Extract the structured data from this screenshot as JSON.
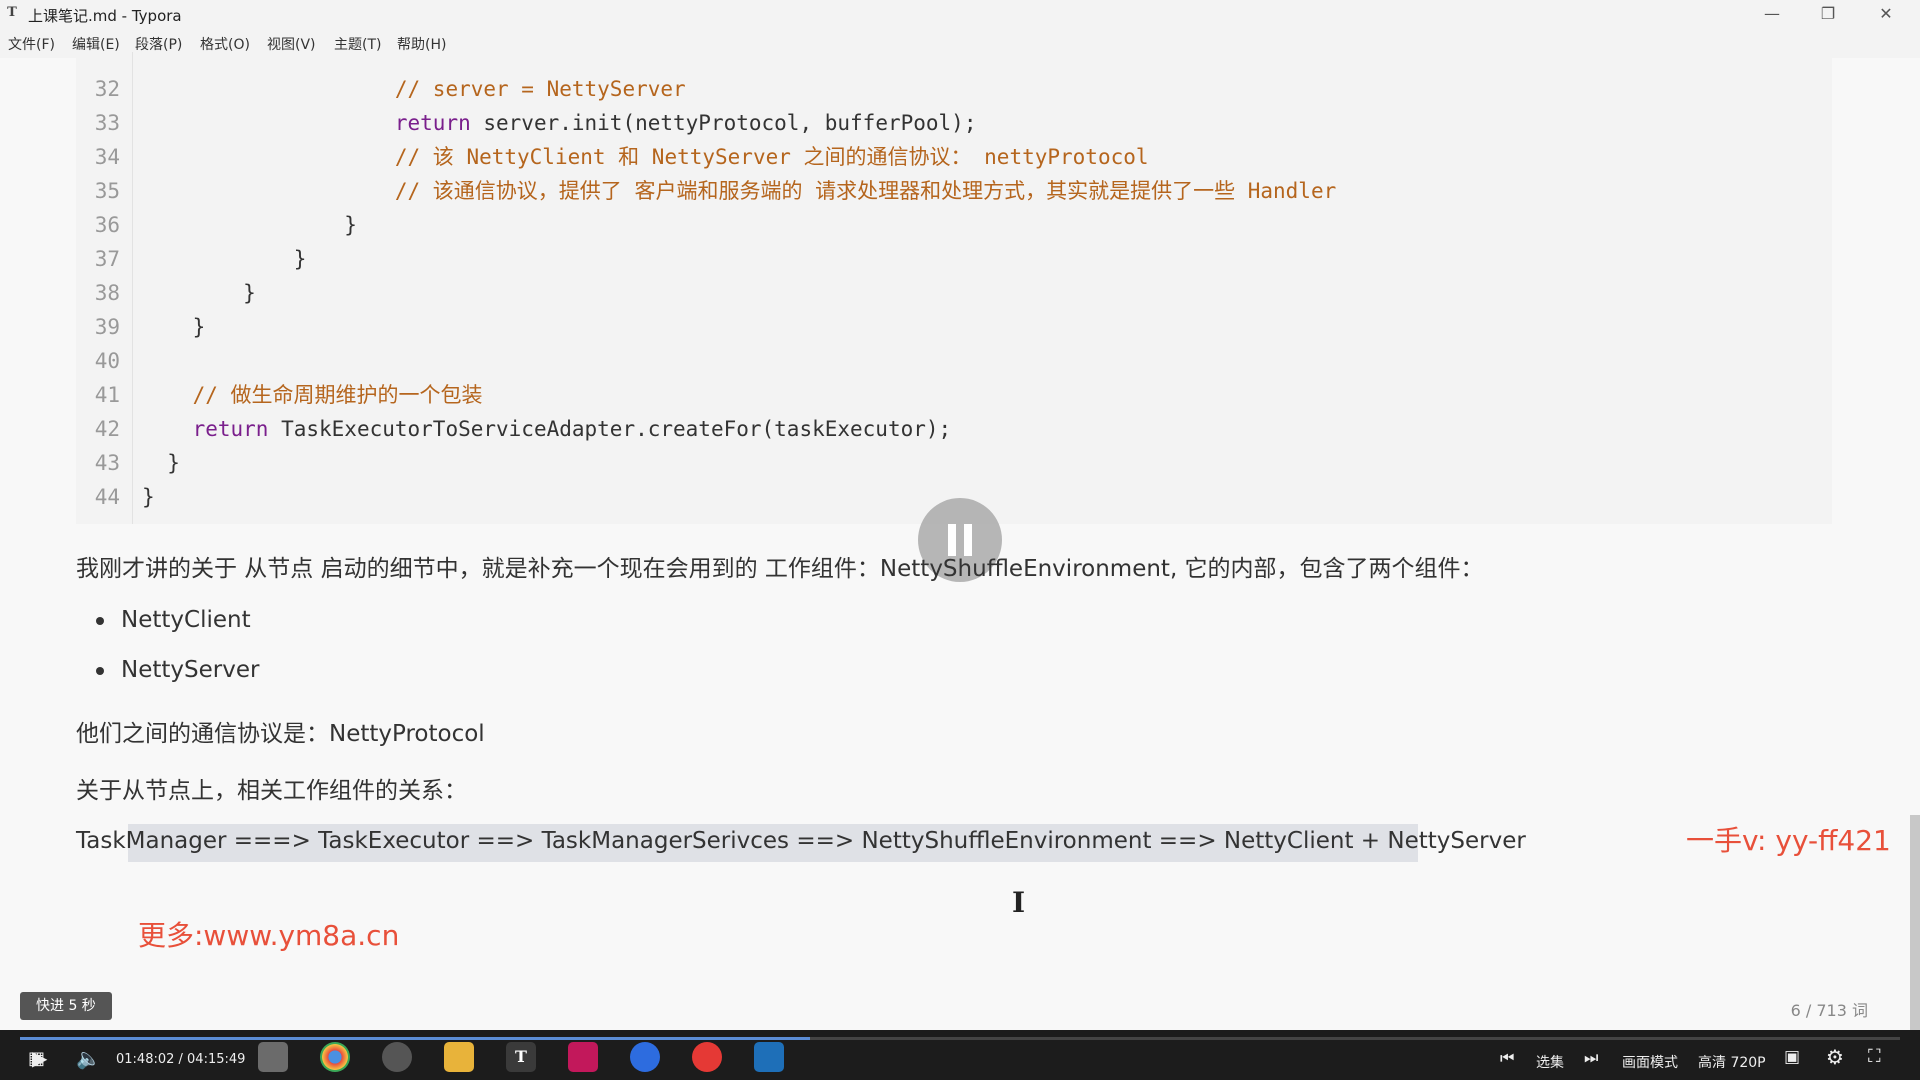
{
  "window": {
    "title": "上课笔记.md - Typora",
    "app_icon": "T"
  },
  "menu": [
    "文件(F)",
    "编辑(E)",
    "段落(P)",
    "格式(O)",
    "视图(V)",
    "主题(T)",
    "帮助(H)"
  ],
  "code": {
    "lines": [
      {
        "n": "32",
        "parts": [
          {
            "t": "                    "
          },
          {
            "t": "// server = NettyServer",
            "c": "cm"
          }
        ]
      },
      {
        "n": "33",
        "parts": [
          {
            "t": "                    "
          },
          {
            "t": "return",
            "c": "kw"
          },
          {
            "t": " server.init(nettyProtocol, bufferPool);"
          }
        ]
      },
      {
        "n": "34",
        "parts": [
          {
            "t": "                    "
          },
          {
            "t": "// 该 NettyClient 和 NettyServer 之间的通信协议： nettyProtocol",
            "c": "cm"
          }
        ]
      },
      {
        "n": "35",
        "parts": [
          {
            "t": "                    "
          },
          {
            "t": "// 该通信协议，提供了 客户端和服务端的 请求处理器和处理方式，其实就是提供了一些 Handler",
            "c": "cm"
          }
        ]
      },
      {
        "n": "36",
        "parts": [
          {
            "t": "                }"
          }
        ]
      },
      {
        "n": "37",
        "parts": [
          {
            "t": "            }"
          }
        ]
      },
      {
        "n": "38",
        "parts": [
          {
            "t": "        }"
          }
        ]
      },
      {
        "n": "39",
        "parts": [
          {
            "t": "    }"
          }
        ]
      },
      {
        "n": "40",
        "parts": [
          {
            "t": ""
          }
        ]
      },
      {
        "n": "41",
        "parts": [
          {
            "t": "    "
          },
          {
            "t": "// 做生命周期维护的一个包装",
            "c": "cm"
          }
        ]
      },
      {
        "n": "42",
        "parts": [
          {
            "t": "    "
          },
          {
            "t": "return",
            "c": "kw"
          },
          {
            "t": " TaskExecutorToServiceAdapter.createFor(taskExecutor);"
          }
        ]
      },
      {
        "n": "43",
        "parts": [
          {
            "t": "  }"
          }
        ]
      },
      {
        "n": "44",
        "parts": [
          {
            "t": "}"
          }
        ]
      }
    ]
  },
  "content": {
    "para1": "我刚才讲的关于 从节点 启动的细节中，就是补充一个现在会用到的 工作组件：NettyShuffleEnvironment, 它的内部，包含了两个组件：",
    "bullets": [
      "NettyClient",
      "NettyServer"
    ],
    "para2": "他们之间的通信协议是：NettyProtocol",
    "para3": "关于从节点上，相关工作组件的关系：",
    "para4": "TaskManager ===> TaskExecutor ==> TaskManagerSerivces ==> NettyShuffleEnvironment ==> NettyClient + NettyServer"
  },
  "watermarks": {
    "more": "更多:www.ym8a.cn",
    "contact": "一手v:  yy-ff421"
  },
  "status": {
    "word_count": "6 / 713 词"
  },
  "toast": "快进 5 秒",
  "player": {
    "time": "01:48:02 / 04:15:49",
    "progress": 0.42,
    "episodes_label": "选集",
    "picture_mode_label": "画面模式",
    "quality_label": "高清 720P"
  },
  "colors": {
    "accent": "#5b8dd6",
    "comment": "#b5651d",
    "keyword": "#7a1f8c",
    "watermark": "#e8503a"
  }
}
